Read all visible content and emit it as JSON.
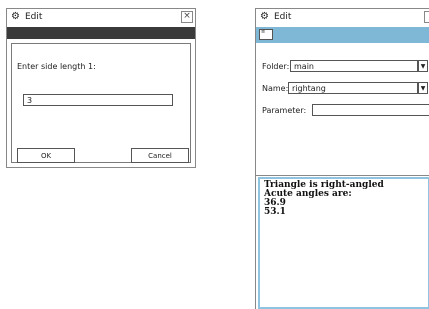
{
  "left_dialog": {
    "title": "Edit",
    "title_icon": "gear-icon",
    "close_glyph": "×",
    "prompt": "Enter side length 1:",
    "input_value": "3",
    "ok_label": "OK",
    "cancel_label": "Cancel"
  },
  "right_window": {
    "title": "Edit",
    "title_icon": "gear-icon",
    "toolbar_icon": "program-editor-icon",
    "toolbar_icon_text": "≡",
    "folder_label": "Folder:",
    "folder_value": "main",
    "name_label": "Name:",
    "name_value": "rightang",
    "parameter_label": "Parameter:",
    "parameter_value": "",
    "dropdown_glyph": "▼",
    "output_lines": [
      "Triangle is right-angled",
      "Acute angles are:",
      "36.9",
      "53.1"
    ]
  },
  "colors": {
    "toolbar": "#7eb8d6",
    "dark_bar": "#3a3a3a",
    "output_border": "#8ec4e0"
  }
}
